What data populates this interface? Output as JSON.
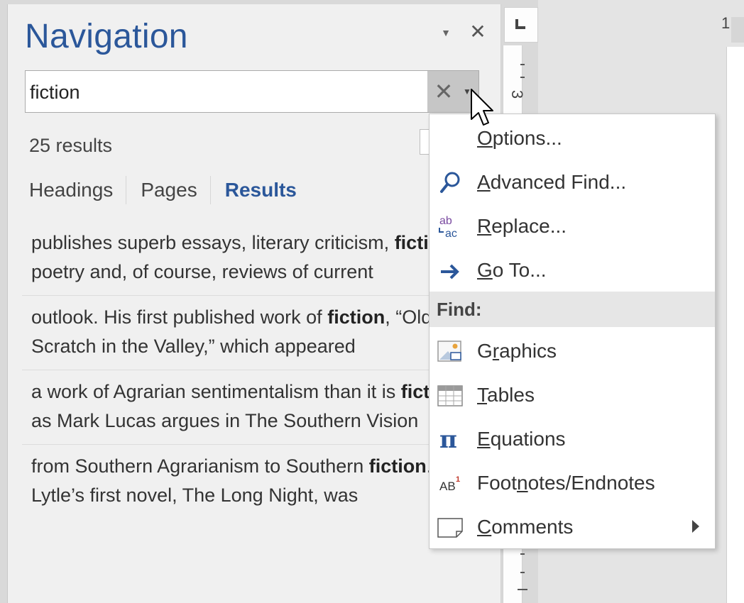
{
  "nav": {
    "title": "Navigation",
    "search_value": "fiction",
    "results_count": "25 results",
    "tabs": [
      {
        "label": "Headings"
      },
      {
        "label": "Pages"
      },
      {
        "label": "Results"
      }
    ],
    "results": [
      {
        "before": "publishes superb essays, literary criticism,",
        "match": "fiction",
        "after": ", poetry and, of course, reviews of current"
      },
      {
        "before": "outlook.  His first published work of",
        "match": "fiction",
        "after": ", “Old Scratch in the Valley,” which appeared"
      },
      {
        "before": "a work of Agrarian sentimentalism than it is",
        "match": "fiction",
        "after": ", as Mark Lucas argues in The Southern Vision"
      },
      {
        "before": "from Southern Agrarianism to Southern",
        "match": "fiction",
        "after": ". Lytle’s first novel, The Long Night, was"
      }
    ]
  },
  "ruler": {
    "number": "3",
    "page_number": "1"
  },
  "menu": {
    "items": [
      {
        "label_pre": "",
        "label_key": "O",
        "label_post": "ptions...",
        "icon": "none"
      },
      {
        "label_pre": "",
        "label_key": "A",
        "label_post": "dvanced Find...",
        "icon": "magnifier-icon"
      },
      {
        "label_pre": "",
        "label_key": "R",
        "label_post": "eplace...",
        "icon": "replace-icon"
      },
      {
        "label_pre": "",
        "label_key": "G",
        "label_post": "o To...",
        "icon": "arrow-right-icon"
      }
    ],
    "section_header": "Find:",
    "find_items": [
      {
        "label_pre": "G",
        "label_key": "r",
        "label_post": "aphics",
        "icon": "graphics-icon"
      },
      {
        "label_pre": "",
        "label_key": "T",
        "label_post": "ables",
        "icon": "table-icon"
      },
      {
        "label_pre": "",
        "label_key": "E",
        "label_post": "quations",
        "icon": "pi-icon"
      },
      {
        "label_pre": "Foot",
        "label_key": "n",
        "label_post": "otes/Endnotes",
        "icon": "footnote-icon"
      },
      {
        "label_pre": "",
        "label_key": "C",
        "label_post": "omments",
        "icon": "comment-icon"
      }
    ],
    "replace_icon_top": "ab",
    "replace_icon_bottom": "ac",
    "footnote_icon_text": "AB",
    "footnote_icon_sup": "1"
  },
  "colors": {
    "accent": "#2b579a",
    "icon_blue": "#2b579a",
    "pane_bg": "#f0f0f0"
  }
}
